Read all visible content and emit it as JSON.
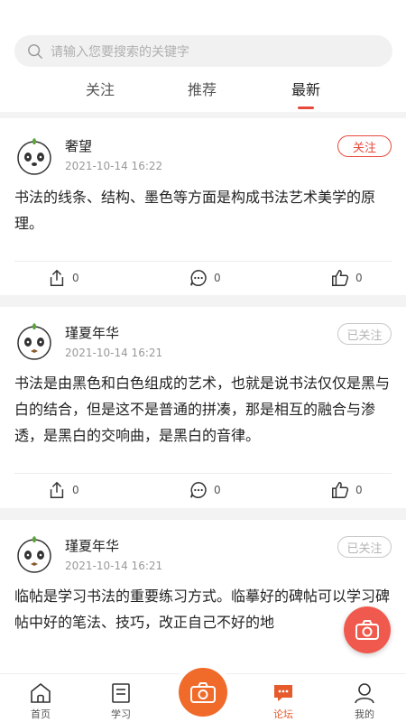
{
  "search": {
    "placeholder": "请输入您要搜索的关键字"
  },
  "tabs": [
    {
      "label": "关注",
      "active": false
    },
    {
      "label": "推荐",
      "active": false
    },
    {
      "label": "最新",
      "active": true
    }
  ],
  "posts": [
    {
      "username": "奢望",
      "time": "2021-10-14 16:22",
      "follow_label": "关注",
      "followed": false,
      "content": "书法的线条、结构、墨色等方面是构成书法艺术美学的原理。",
      "share_count": "0",
      "comment_count": "0",
      "like_count": "0"
    },
    {
      "username": "瑾夏年华",
      "time": "2021-10-14 16:21",
      "follow_label": "已关注",
      "followed": true,
      "content": "书法是由黑色和白色组成的艺术，也就是说书法仅仅是黑与白的结合，但是这不是普通的拼凑，那是相互的融合与渗透，是黑白的交响曲，是黑白的音律。",
      "share_count": "0",
      "comment_count": "0",
      "like_count": "0"
    },
    {
      "username": "瑾夏年华",
      "time": "2021-10-14 16:21",
      "follow_label": "已关注",
      "followed": true,
      "content": "临帖是学习书法的重要练习方式。临摹好的碑帖可以学习碑帖中好的笔法、技巧，改正自己不好的地"
    }
  ],
  "tabbar": [
    {
      "label": "首页",
      "icon": "home-icon",
      "active": false
    },
    {
      "label": "学习",
      "icon": "book-icon",
      "active": false
    },
    {
      "label": "",
      "icon": "camera-icon",
      "active": false
    },
    {
      "label": "论坛",
      "icon": "forum-icon",
      "active": true
    },
    {
      "label": "我的",
      "icon": "profile-icon",
      "active": false
    }
  ],
  "colors": {
    "accent": "#e64a3c",
    "center_button": "#f06a2a",
    "fab": "#f05a4e"
  }
}
